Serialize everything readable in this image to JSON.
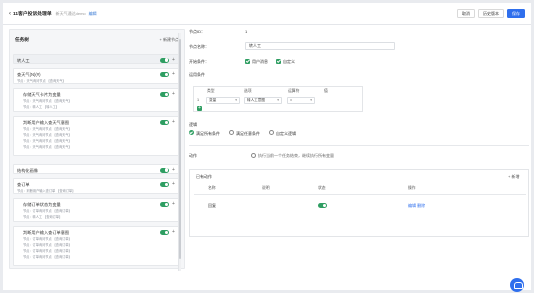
{
  "header": {
    "title": "11客户投诉处理单",
    "crumb": "新天气通达demo",
    "edit_label": "编辑",
    "buttons": [
      "取消",
      "历史版本",
      "保存"
    ]
  },
  "left": {
    "title": "任务树",
    "add_label": "+ 新建节点",
    "nodes": [
      {
        "title": "转人工",
        "subs": []
      },
      {
        "title": "查天气(N)(#)",
        "subs": [
          "节点：天气询问节点 【查询天气】"
        ]
      },
      {
        "title": "存储天气卡片为变量",
        "subs": [
          "节点：天气询问节点 【查询天气】",
          "节点：转人工 【转人工】"
        ]
      },
      {
        "title": "判断用户输入查天气意图",
        "subs": [
          "节点：天气询问节点 【查询天气】",
          "节点：天气询问节点 【查询天气】",
          "节点：天气询问节点 【查询天气】",
          "节点：天气询问节点 【查询天气】"
        ]
      },
      {
        "title": "结构化画像",
        "subs": []
      },
      {
        "title": "查订单",
        "subs": [
          "节点：判断用户输入查订单 【查询订单】"
        ]
      },
      {
        "title": "存储订单状态为变量",
        "subs": [
          "节点：订单询问节点 【查询订单】",
          "节点：转人工 【查询订单】"
        ]
      },
      {
        "title": "判断用户输入查订单意图",
        "subs": [
          "节点：订单询问节点 【查询订单】",
          "节点：订单询问节点 【查询订单】",
          "节点：订单询问节点 【查询订单】",
          "节点：订单询问节点 【查询订单】"
        ]
      }
    ]
  },
  "right": {
    "node_id_label": "节点ID：",
    "node_id_value": "1",
    "node_name_label": "节点名称：",
    "node_name_value": "转人工",
    "trigger_label": "开始条件：",
    "trigger_options": [
      "用户消息",
      "自定义"
    ],
    "condition_label": "运用条件",
    "table_headers": [
      "类型",
      "选项",
      "运算符",
      "值"
    ],
    "row": {
      "index": "1",
      "type": "变量",
      "option": "转人工意图",
      "operator": "="
    },
    "logic_label": "逻辑",
    "logic_options": [
      "满足所有条件",
      "满足任意条件",
      "自定义逻辑"
    ],
    "action_label": "动作",
    "action_hint": "执行当前一个任务结束，继续执行所有变量",
    "op_title": "已有动作",
    "op_add": "+ 新增",
    "op_headers": [
      "名称",
      "说明",
      "状态",
      "操作"
    ],
    "op_rows": [
      {
        "name": "回复",
        "desc": "",
        "ops": "编辑 删除"
      }
    ]
  },
  "colors": {
    "accent": "#2f6fed",
    "green": "#2f9e62"
  }
}
